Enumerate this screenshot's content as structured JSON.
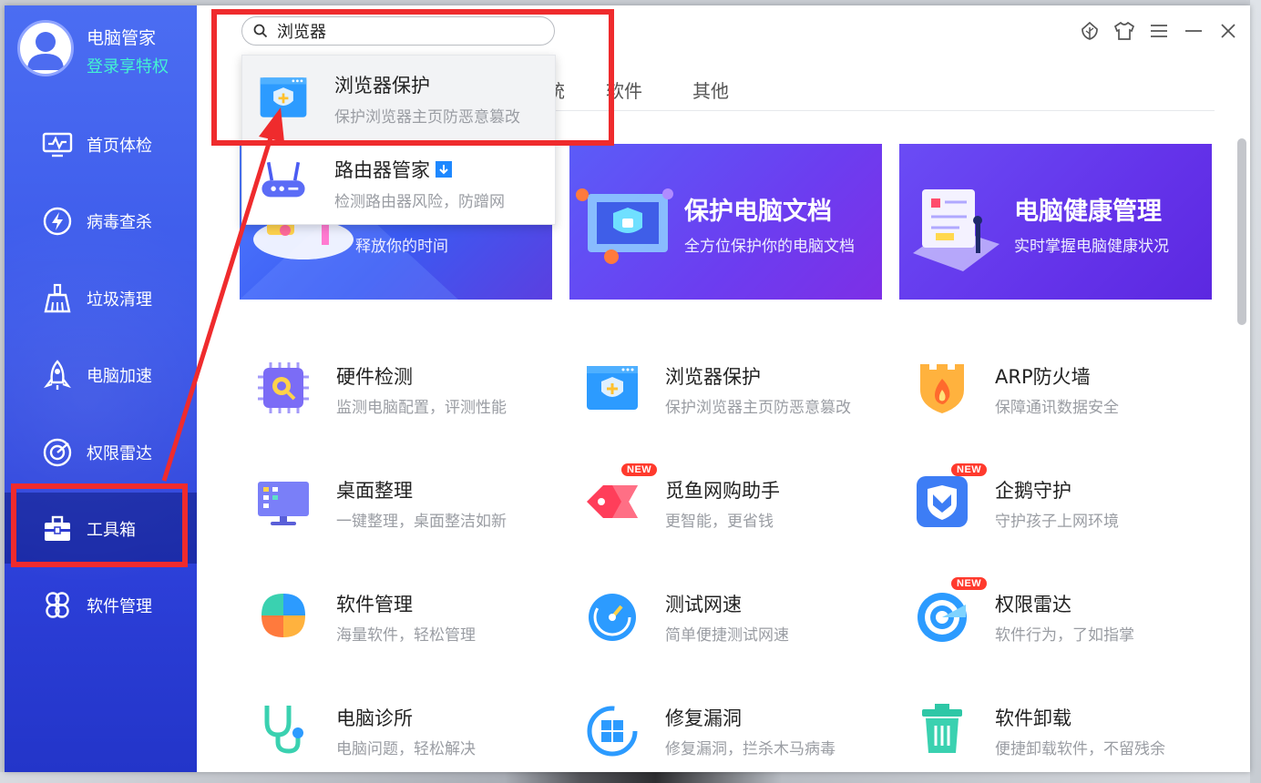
{
  "user": {
    "name": "电脑管家",
    "login_text": "登录享特权"
  },
  "sidebar": {
    "items": [
      {
        "label": "首页体检",
        "icon": "monitor-pulse-icon"
      },
      {
        "label": "病毒查杀",
        "icon": "lightning-circle-icon"
      },
      {
        "label": "垃圾清理",
        "icon": "broom-icon"
      },
      {
        "label": "电脑加速",
        "icon": "rocket-icon"
      },
      {
        "label": "权限雷达",
        "icon": "radar-icon"
      },
      {
        "label": "工具箱",
        "icon": "toolbox-icon",
        "active": true
      },
      {
        "label": "软件管理",
        "icon": "clover-icon"
      }
    ]
  },
  "search": {
    "value": "浏览器",
    "placeholder": ""
  },
  "tabs": [
    "系统",
    "软件",
    "其他"
  ],
  "tabs_visible_fragments": [
    "统",
    "软件",
    "其他"
  ],
  "dropdown": {
    "items": [
      {
        "name": "浏览器保护",
        "desc": "保护浏览器主页防恶意篡改"
      },
      {
        "name": "路由器管家",
        "desc": "检测路由器风险，防蹭网",
        "download_badge": true
      }
    ]
  },
  "banners": [
    {
      "title": "",
      "subtitle": "释放你的时间"
    },
    {
      "title": "保护电脑文档",
      "subtitle": "全方位保护你的电脑文档"
    },
    {
      "title": "电脑健康管理",
      "subtitle": "实时掌握电脑健康状况"
    }
  ],
  "tools": [
    {
      "name": "硬件检测",
      "desc": "监测电脑配置，评测性能",
      "icon": "chip-search-icon"
    },
    {
      "name": "浏览器保护",
      "desc": "保护浏览器主页防恶意篡改",
      "icon": "browser-shield-icon"
    },
    {
      "name": "ARP防火墙",
      "desc": "保障通讯数据安全",
      "icon": "firewall-icon"
    },
    {
      "name": "桌面整理",
      "desc": "一键整理，桌面整洁如新",
      "icon": "desktop-icon"
    },
    {
      "name": "觅鱼网购助手",
      "desc": "更智能，更省钱",
      "icon": "price-tag-icon",
      "badge": "NEW"
    },
    {
      "name": "企鹅守护",
      "desc": "守护孩子上网环境",
      "icon": "penguin-shield-icon",
      "badge": "NEW"
    },
    {
      "name": "软件管理",
      "desc": "海量软件，轻松管理",
      "icon": "clover-app-icon"
    },
    {
      "name": "测试网速",
      "desc": "简单便捷测试网速",
      "icon": "speedometer-icon"
    },
    {
      "name": "权限雷达",
      "desc": "软件行为，了如指掌",
      "icon": "radar-app-icon",
      "badge": "NEW"
    },
    {
      "name": "电脑诊所",
      "desc": "电脑问题，轻松解决",
      "icon": "stethoscope-icon"
    },
    {
      "name": "修复漏洞",
      "desc": "修复漏洞，拦杀木马病毒",
      "icon": "windows-repair-icon"
    },
    {
      "name": "软件卸载",
      "desc": "便捷卸载软件，不留残余",
      "icon": "trash-icon"
    }
  ],
  "colors": {
    "sidebar_top": "#4b6df2",
    "sidebar_bottom": "#2335c9",
    "accent_green": "#44f2d2",
    "annotation_red": "#ef2b2d"
  }
}
